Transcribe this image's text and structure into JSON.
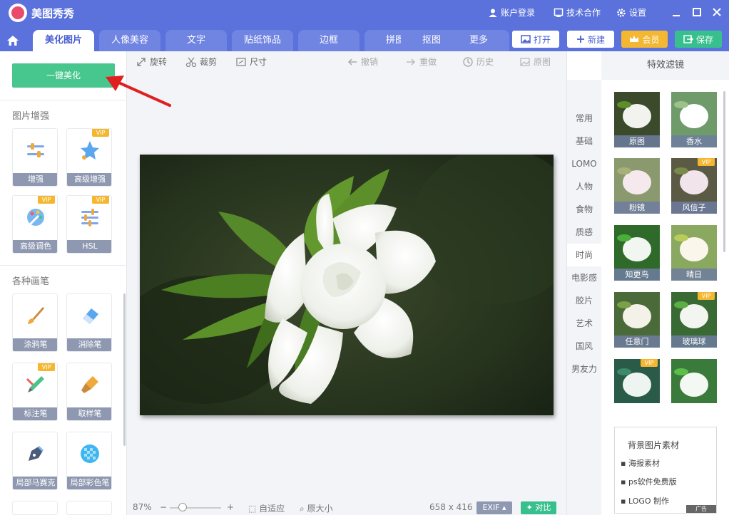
{
  "app": {
    "title": "美图秀秀"
  },
  "titlebar": {
    "login": "账户登录",
    "support": "技术合作",
    "settings": "设置"
  },
  "nav": {
    "tabs": [
      "美化图片",
      "人像美容",
      "文字",
      "贴纸饰品",
      "边框",
      "拼图",
      "抠图",
      "更多"
    ],
    "active_tab": "美化图片",
    "open": "打开",
    "new": "新建",
    "vip": "会员",
    "save": "保存"
  },
  "left_panel": {
    "one_click": "一键美化",
    "enhance_title": "图片增强",
    "enhance_tools": [
      {
        "label": "增强",
        "vip": false
      },
      {
        "label": "高级增强",
        "vip": true
      },
      {
        "label": "高级调色",
        "vip": true
      },
      {
        "label": "HSL",
        "vip": true
      }
    ],
    "brush_title": "各种画笔",
    "brush_tools": [
      {
        "label": "涂鸦笔",
        "vip": false
      },
      {
        "label": "消除笔",
        "vip": false
      },
      {
        "label": "标注笔",
        "vip": true
      },
      {
        "label": "取样笔",
        "vip": false
      },
      {
        "label": "局部马赛克",
        "vip": false
      },
      {
        "label": "局部彩色笔",
        "vip": false
      }
    ],
    "vip_badge": "VIP"
  },
  "toolbar": {
    "rotate": "旋转",
    "crop": "裁剪",
    "size": "尺寸",
    "undo": "撤销",
    "redo": "重做",
    "history": "历史",
    "original": "原图"
  },
  "statusbar": {
    "zoom": "87%",
    "fit": "自适应",
    "actual": "原大小",
    "dimensions": "658 x 416",
    "exif": "EXIF",
    "compare": "对比"
  },
  "right_panel": {
    "title": "特效滤镜",
    "categories": [
      "常用",
      "基础",
      "LOMO",
      "人物",
      "食物",
      "质感",
      "时尚",
      "电影感",
      "胶片",
      "艺术",
      "国风",
      "男友力"
    ],
    "active_category": "时尚",
    "filters": [
      {
        "label": "原图",
        "vip": false
      },
      {
        "label": "香水",
        "vip": false
      },
      {
        "label": "粉镜",
        "vip": false
      },
      {
        "label": "风信子",
        "vip": true
      },
      {
        "label": "知更鸟",
        "vip": false
      },
      {
        "label": "晴日",
        "vip": false
      },
      {
        "label": "任意门",
        "vip": false
      },
      {
        "label": "玻璃球",
        "vip": true
      },
      {
        "label": "",
        "vip": true
      },
      {
        "label": "",
        "vip": false
      }
    ],
    "ad": {
      "title": "背景图片素材",
      "items": [
        "海报素材",
        "ps软件免费版",
        "LOGO 制作"
      ],
      "badge": "广告"
    }
  },
  "colors": {
    "brand": "#5b72dd",
    "green": "#37c08e",
    "vip": "#f4b731",
    "annotation": "#e02020"
  }
}
